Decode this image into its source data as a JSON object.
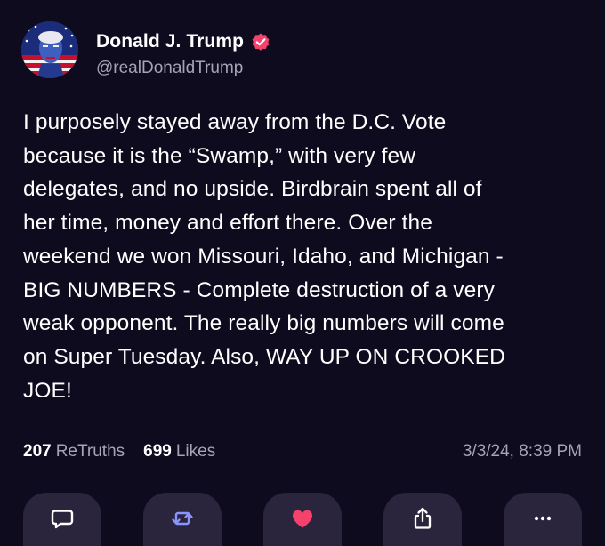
{
  "author": {
    "display_name": "Donald J. Trump",
    "handle": "@realDonaldTrump",
    "verified": true,
    "verified_badge_color": "#f5426c"
  },
  "post": {
    "text": "I purposely stayed away from the D.C. Vote\nbecause it is the “Swamp,” with very few\ndelegates, and no upside. Birdbrain spent all of\nher time, money and effort there. Over the\nweekend we won Missouri, Idaho, and Michigan -\nBIG NUMBERS - Complete destruction of a very\nweak opponent. The really big numbers will come\non Super Tuesday. Also, WAY UP ON CROOKED\nJOE!",
    "retruths_count": "207",
    "retruths_label": "ReTruths",
    "likes_count": "699",
    "likes_label": "Likes",
    "timestamp": "3/3/24, 8:39 PM"
  },
  "actions": [
    {
      "name": "reply",
      "icon": "chat-bubble-icon",
      "color": "#ffffff"
    },
    {
      "name": "retruth",
      "icon": "repost-arrows-icon",
      "color": "#8b93ff"
    },
    {
      "name": "like",
      "icon": "heart-icon",
      "color": "#f5426c"
    },
    {
      "name": "share",
      "icon": "share-icon",
      "color": "#ffffff"
    },
    {
      "name": "more",
      "icon": "more-dots-icon",
      "color": "#ffffff"
    }
  ],
  "colors": {
    "background": "#0f0b1f",
    "action_button_bg": "#2a253d",
    "muted_text": "#a7a3b7"
  }
}
